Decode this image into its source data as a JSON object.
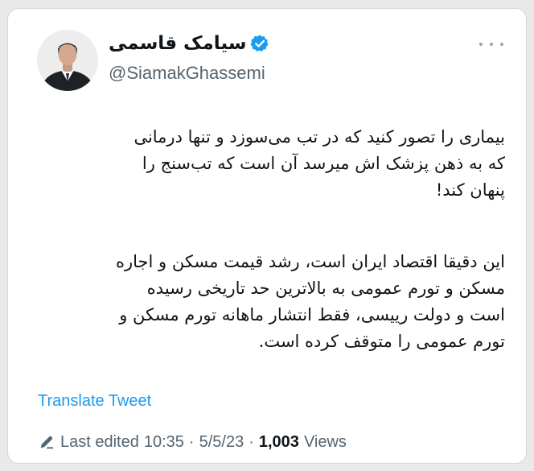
{
  "tweet": {
    "author": {
      "display_name": "سیامک قاسمی",
      "handle": "@SiamakGhassemi",
      "verified": true
    },
    "text": {
      "paragraph1": [
        "بیماری را تصور کنید که در تب می‌سوزد و تنها درمانی",
        "که به ذهن پزشک اش میرسد آن است که تب‌سنج را",
        "پنهان کند!"
      ],
      "paragraph2": [
        "این دقیقا اقتصاد ایران است، رشد قیمت مسکن و اجاره",
        "مسکن و تورم عمومی به بالاترین حد تاریخی رسیده",
        "است و دولت رییسی، فقط انتشار ماهانه تورم مسکن و",
        "تورم عمومی را متوقف کرده است."
      ]
    },
    "translate_label": "Translate Tweet",
    "meta": {
      "edit_label": "Last edited",
      "time": "10:35",
      "separator": "·",
      "date": "5/5/23",
      "views_count": "1,003",
      "views_label": "Views"
    }
  },
  "icons": {
    "verified": "verified-badge-icon",
    "more": "more-options-icon",
    "edit": "pencil-edit-icon"
  },
  "colors": {
    "accent": "#1d9bf0",
    "text_primary": "#0f1419",
    "text_secondary": "#536471",
    "card_border": "#cfd9de"
  }
}
